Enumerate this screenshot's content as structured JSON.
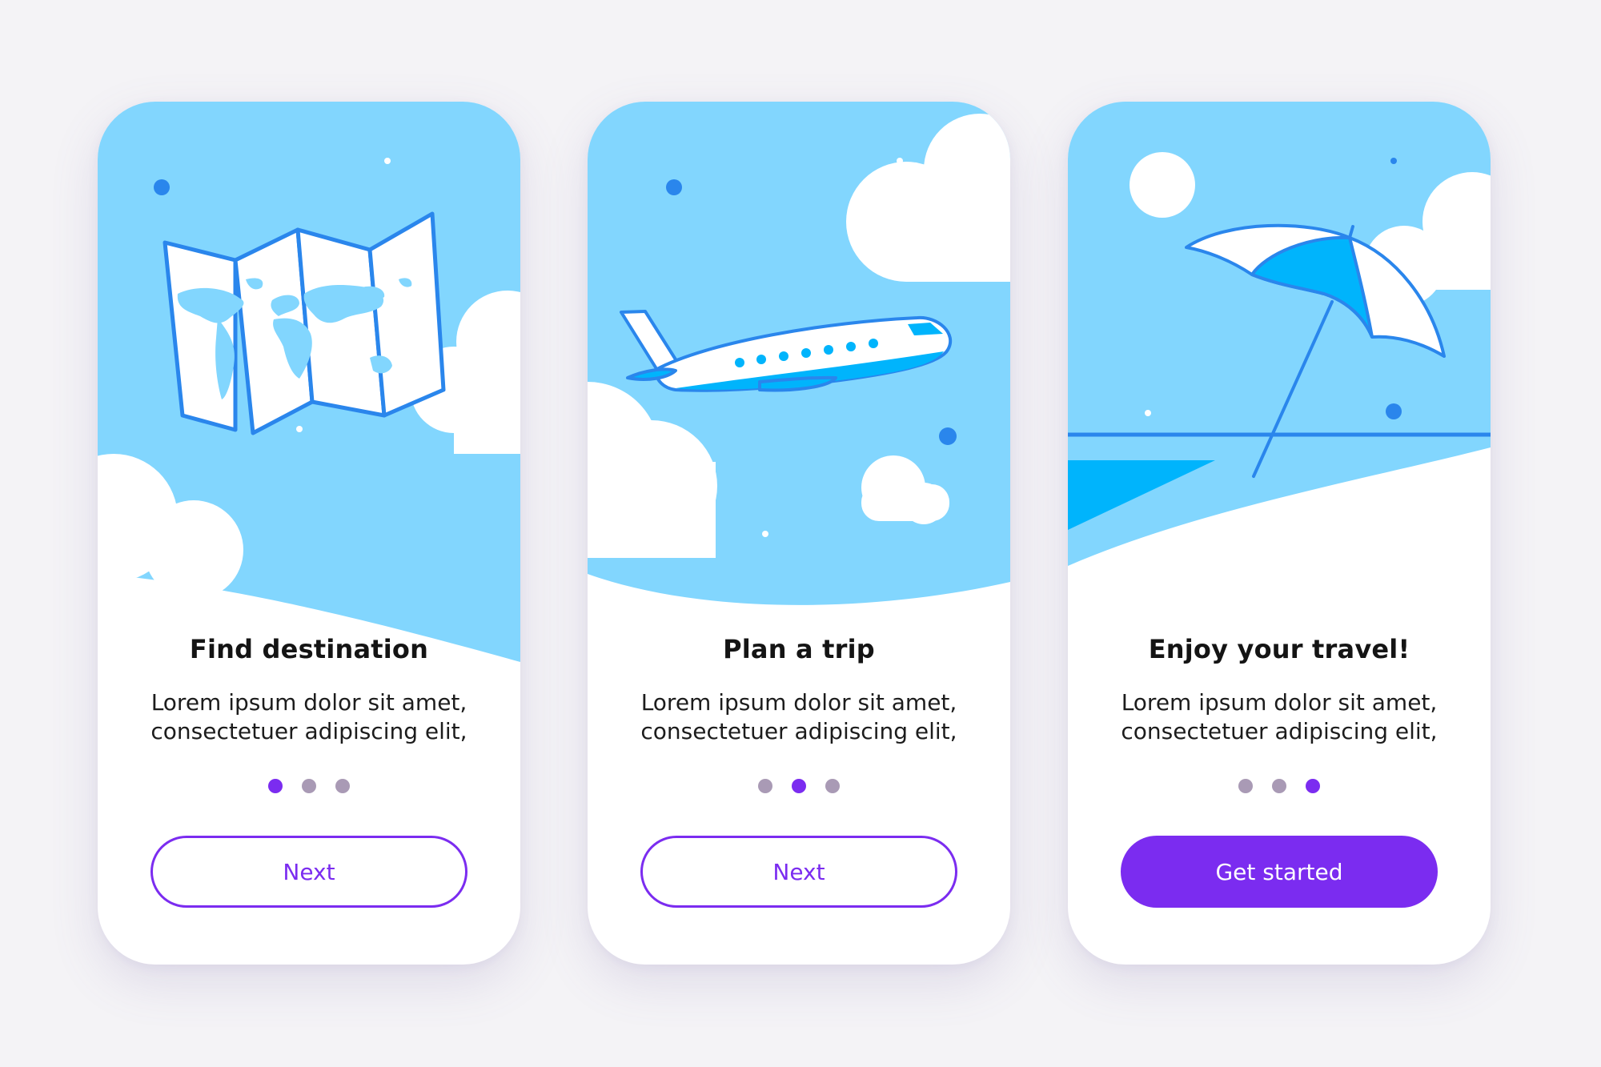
{
  "colors": {
    "background": "#f4f3f6",
    "sky": "#82d6fe",
    "accent_purple": "#7b2cf0",
    "inactive_dot": "#a99ab5",
    "outline_blue": "#2a86ec",
    "fill_blue": "#00b4fc",
    "cloud": "#ffffff"
  },
  "screens": [
    {
      "illustration_icon": "folded-world-map-icon",
      "title": "Find destination",
      "body_line_1": "Lorem ipsum dolor sit amet,",
      "body_line_2": "consectetuer adipiscing elit,",
      "pagination_active_index": 0,
      "pagination_total": 3,
      "button_label": "Next",
      "button_style": "outline"
    },
    {
      "illustration_icon": "airplane-icon",
      "title": "Plan a trip",
      "body_line_1": "Lorem ipsum dolor sit amet,",
      "body_line_2": "consectetuer adipiscing elit,",
      "pagination_active_index": 1,
      "pagination_total": 3,
      "button_label": "Next",
      "button_style": "outline"
    },
    {
      "illustration_icon": "beach-umbrella-icon",
      "title": "Enjoy your travel!",
      "body_line_1": "Lorem ipsum dolor sit amet,",
      "body_line_2": "consectetuer adipiscing elit,",
      "pagination_active_index": 2,
      "pagination_total": 3,
      "button_label": "Get started",
      "button_style": "filled"
    }
  ]
}
